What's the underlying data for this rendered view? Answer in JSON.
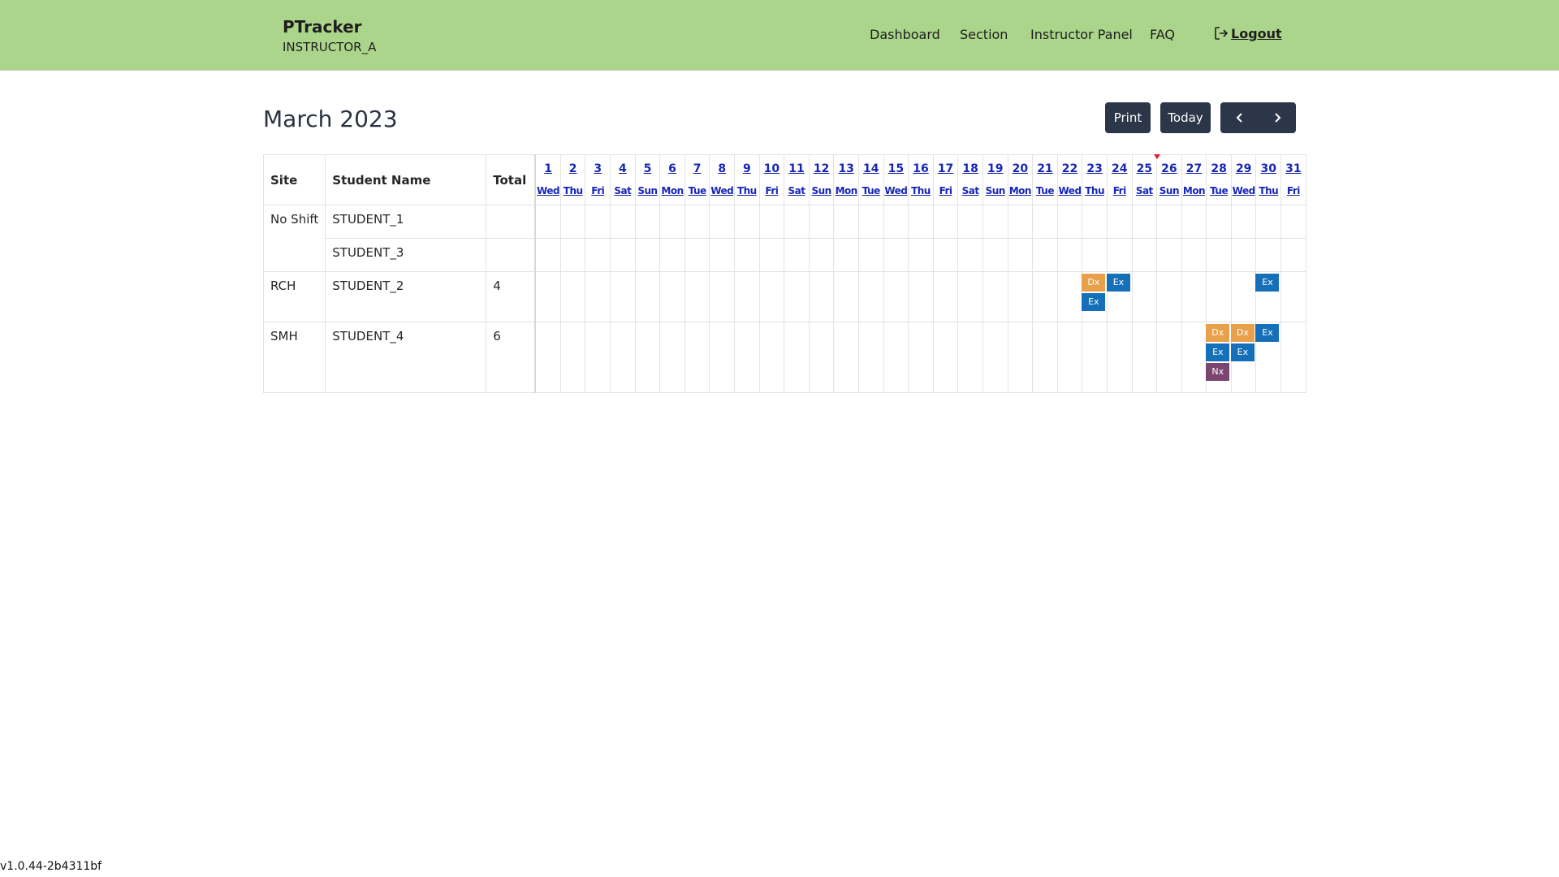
{
  "header": {
    "app_name": "PTracker",
    "user": "INSTRUCTOR_A",
    "nav": [
      "Dashboard",
      "Section",
      "Instructor Panel",
      "FAQ"
    ],
    "logout_label": "Logout",
    "bg_color": "#abd58a"
  },
  "calendar": {
    "month_title": "March 2023",
    "buttons": {
      "print": "Print",
      "today": "Today",
      "prev_icon": "chevron-left-icon",
      "next_icon": "chevron-right-icon"
    },
    "columns": {
      "site": "Site",
      "student_name": "Student Name",
      "total": "Total"
    },
    "today_day": 26,
    "days": [
      {
        "n": "1",
        "wd": "Wed"
      },
      {
        "n": "2",
        "wd": "Thu"
      },
      {
        "n": "3",
        "wd": "Fri"
      },
      {
        "n": "4",
        "wd": "Sat"
      },
      {
        "n": "5",
        "wd": "Sun"
      },
      {
        "n": "6",
        "wd": "Mon"
      },
      {
        "n": "7",
        "wd": "Tue"
      },
      {
        "n": "8",
        "wd": "Wed"
      },
      {
        "n": "9",
        "wd": "Thu"
      },
      {
        "n": "10",
        "wd": "Fri"
      },
      {
        "n": "11",
        "wd": "Sat"
      },
      {
        "n": "12",
        "wd": "Sun"
      },
      {
        "n": "13",
        "wd": "Mon"
      },
      {
        "n": "14",
        "wd": "Tue"
      },
      {
        "n": "15",
        "wd": "Wed"
      },
      {
        "n": "16",
        "wd": "Thu"
      },
      {
        "n": "17",
        "wd": "Fri"
      },
      {
        "n": "18",
        "wd": "Sat"
      },
      {
        "n": "19",
        "wd": "Sun"
      },
      {
        "n": "20",
        "wd": "Mon"
      },
      {
        "n": "21",
        "wd": "Tue"
      },
      {
        "n": "22",
        "wd": "Wed"
      },
      {
        "n": "23",
        "wd": "Thu"
      },
      {
        "n": "24",
        "wd": "Fri"
      },
      {
        "n": "25",
        "wd": "Sat"
      },
      {
        "n": "26",
        "wd": "Sun"
      },
      {
        "n": "27",
        "wd": "Mon"
      },
      {
        "n": "28",
        "wd": "Tue"
      },
      {
        "n": "29",
        "wd": "Wed"
      },
      {
        "n": "30",
        "wd": "Thu"
      },
      {
        "n": "31",
        "wd": "Fri"
      }
    ],
    "groups": [
      {
        "site": "No Shift",
        "students": [
          {
            "name": "STUDENT_1",
            "total": "",
            "shifts": {}
          },
          {
            "name": "STUDENT_3",
            "total": "",
            "shifts": {}
          }
        ]
      },
      {
        "site": "RCH",
        "students": [
          {
            "name": "STUDENT_2",
            "total": "4",
            "shifts": {
              "23": [
                "Dx",
                "Ex"
              ],
              "24": [
                "Ex"
              ],
              "30": [
                "Ex"
              ]
            }
          }
        ]
      },
      {
        "site": "SMH",
        "students": [
          {
            "name": "STUDENT_4",
            "total": "6",
            "shifts": {
              "28": [
                "Dx",
                "Ex",
                "Nx"
              ],
              "29": [
                "Dx",
                "Ex"
              ],
              "30": [
                "Ex"
              ]
            }
          }
        ]
      }
    ],
    "tag_colors": {
      "Dx": "#e8a04b",
      "Ex": "#1670b9",
      "Nx": "#7a466f"
    }
  },
  "footer": {
    "version": "v1.0.44-2b4311bf"
  }
}
